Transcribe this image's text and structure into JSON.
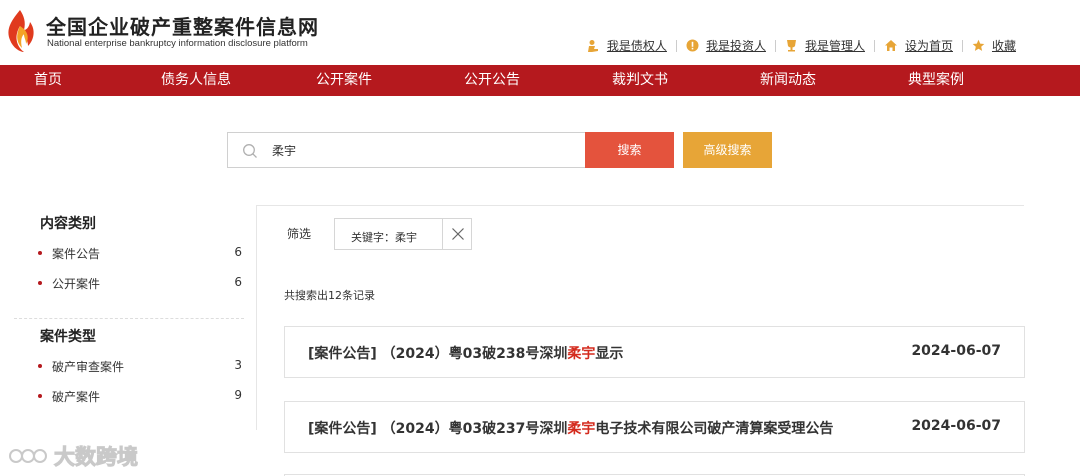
{
  "site": {
    "title": "全国企业破产重整案件信息网",
    "subtitle": "National enterprise bankruptcy information disclosure platform"
  },
  "toplinks": [
    {
      "label": "我是债权人",
      "icon": "creditor-icon"
    },
    {
      "label": "我是投资人",
      "icon": "investor-icon"
    },
    {
      "label": "我是管理人",
      "icon": "administrator-icon"
    },
    {
      "label": "设为首页",
      "icon": "home-icon"
    },
    {
      "label": "收藏",
      "icon": "star-icon"
    }
  ],
  "nav": [
    {
      "label": "首页"
    },
    {
      "label": "债务人信息"
    },
    {
      "label": "公开案件"
    },
    {
      "label": "公开公告"
    },
    {
      "label": "裁判文书"
    },
    {
      "label": "新闻动态"
    },
    {
      "label": "典型案例"
    }
  ],
  "search": {
    "value": "柔宇",
    "search_label": "搜索",
    "advanced_label": "高级搜索"
  },
  "sidebar": {
    "content_category": {
      "heading": "内容类别",
      "items": [
        {
          "label": "案件公告",
          "count": "6"
        },
        {
          "label": "公开案件",
          "count": "6"
        }
      ]
    },
    "case_type": {
      "heading": "案件类型",
      "items": [
        {
          "label": "破产审查案件",
          "count": "3"
        },
        {
          "label": "破产案件",
          "count": "9"
        }
      ]
    }
  },
  "filter": {
    "label": "筛选",
    "tag": "关键字：柔宇"
  },
  "results": {
    "summary": "共搜索出12条记录",
    "items": [
      {
        "prefix": "[案件公告] （2024）粤03破238号深圳",
        "highlight": "柔宇",
        "suffix": "显示",
        "date": "2024-06-07"
      },
      {
        "prefix": "[案件公告] （2024）粤03破237号深圳",
        "highlight": "柔宇",
        "suffix": "电子技术有限公司破产清算案受理公告",
        "date": "2024-06-07"
      }
    ]
  },
  "watermark": {
    "text": "大数跨境"
  },
  "colors": {
    "brand_red": "#b5191e",
    "search_button": "#e4533d",
    "advanced_button": "#e7a537",
    "highlight": "#d42b1e"
  }
}
